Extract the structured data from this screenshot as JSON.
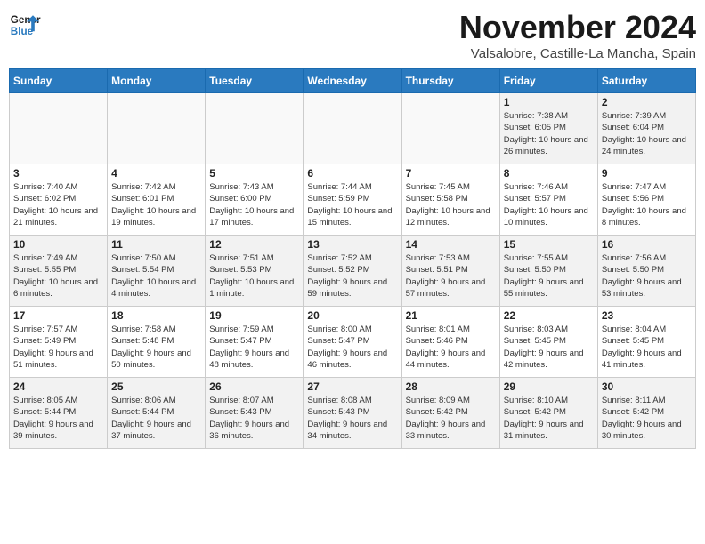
{
  "logo": {
    "line1": "General",
    "line2": "Blue"
  },
  "title": "November 2024",
  "subtitle": "Valsalobre, Castille-La Mancha, Spain",
  "weekdays": [
    "Sunday",
    "Monday",
    "Tuesday",
    "Wednesday",
    "Thursday",
    "Friday",
    "Saturday"
  ],
  "weeks": [
    [
      {
        "day": "",
        "info": ""
      },
      {
        "day": "",
        "info": ""
      },
      {
        "day": "",
        "info": ""
      },
      {
        "day": "",
        "info": ""
      },
      {
        "day": "",
        "info": ""
      },
      {
        "day": "1",
        "info": "Sunrise: 7:38 AM\nSunset: 6:05 PM\nDaylight: 10 hours and 26 minutes."
      },
      {
        "day": "2",
        "info": "Sunrise: 7:39 AM\nSunset: 6:04 PM\nDaylight: 10 hours and 24 minutes."
      }
    ],
    [
      {
        "day": "3",
        "info": "Sunrise: 7:40 AM\nSunset: 6:02 PM\nDaylight: 10 hours and 21 minutes."
      },
      {
        "day": "4",
        "info": "Sunrise: 7:42 AM\nSunset: 6:01 PM\nDaylight: 10 hours and 19 minutes."
      },
      {
        "day": "5",
        "info": "Sunrise: 7:43 AM\nSunset: 6:00 PM\nDaylight: 10 hours and 17 minutes."
      },
      {
        "day": "6",
        "info": "Sunrise: 7:44 AM\nSunset: 5:59 PM\nDaylight: 10 hours and 15 minutes."
      },
      {
        "day": "7",
        "info": "Sunrise: 7:45 AM\nSunset: 5:58 PM\nDaylight: 10 hours and 12 minutes."
      },
      {
        "day": "8",
        "info": "Sunrise: 7:46 AM\nSunset: 5:57 PM\nDaylight: 10 hours and 10 minutes."
      },
      {
        "day": "9",
        "info": "Sunrise: 7:47 AM\nSunset: 5:56 PM\nDaylight: 10 hours and 8 minutes."
      }
    ],
    [
      {
        "day": "10",
        "info": "Sunrise: 7:49 AM\nSunset: 5:55 PM\nDaylight: 10 hours and 6 minutes."
      },
      {
        "day": "11",
        "info": "Sunrise: 7:50 AM\nSunset: 5:54 PM\nDaylight: 10 hours and 4 minutes."
      },
      {
        "day": "12",
        "info": "Sunrise: 7:51 AM\nSunset: 5:53 PM\nDaylight: 10 hours and 1 minute."
      },
      {
        "day": "13",
        "info": "Sunrise: 7:52 AM\nSunset: 5:52 PM\nDaylight: 9 hours and 59 minutes."
      },
      {
        "day": "14",
        "info": "Sunrise: 7:53 AM\nSunset: 5:51 PM\nDaylight: 9 hours and 57 minutes."
      },
      {
        "day": "15",
        "info": "Sunrise: 7:55 AM\nSunset: 5:50 PM\nDaylight: 9 hours and 55 minutes."
      },
      {
        "day": "16",
        "info": "Sunrise: 7:56 AM\nSunset: 5:50 PM\nDaylight: 9 hours and 53 minutes."
      }
    ],
    [
      {
        "day": "17",
        "info": "Sunrise: 7:57 AM\nSunset: 5:49 PM\nDaylight: 9 hours and 51 minutes."
      },
      {
        "day": "18",
        "info": "Sunrise: 7:58 AM\nSunset: 5:48 PM\nDaylight: 9 hours and 50 minutes."
      },
      {
        "day": "19",
        "info": "Sunrise: 7:59 AM\nSunset: 5:47 PM\nDaylight: 9 hours and 48 minutes."
      },
      {
        "day": "20",
        "info": "Sunrise: 8:00 AM\nSunset: 5:47 PM\nDaylight: 9 hours and 46 minutes."
      },
      {
        "day": "21",
        "info": "Sunrise: 8:01 AM\nSunset: 5:46 PM\nDaylight: 9 hours and 44 minutes."
      },
      {
        "day": "22",
        "info": "Sunrise: 8:03 AM\nSunset: 5:45 PM\nDaylight: 9 hours and 42 minutes."
      },
      {
        "day": "23",
        "info": "Sunrise: 8:04 AM\nSunset: 5:45 PM\nDaylight: 9 hours and 41 minutes."
      }
    ],
    [
      {
        "day": "24",
        "info": "Sunrise: 8:05 AM\nSunset: 5:44 PM\nDaylight: 9 hours and 39 minutes."
      },
      {
        "day": "25",
        "info": "Sunrise: 8:06 AM\nSunset: 5:44 PM\nDaylight: 9 hours and 37 minutes."
      },
      {
        "day": "26",
        "info": "Sunrise: 8:07 AM\nSunset: 5:43 PM\nDaylight: 9 hours and 36 minutes."
      },
      {
        "day": "27",
        "info": "Sunrise: 8:08 AM\nSunset: 5:43 PM\nDaylight: 9 hours and 34 minutes."
      },
      {
        "day": "28",
        "info": "Sunrise: 8:09 AM\nSunset: 5:42 PM\nDaylight: 9 hours and 33 minutes."
      },
      {
        "day": "29",
        "info": "Sunrise: 8:10 AM\nSunset: 5:42 PM\nDaylight: 9 hours and 31 minutes."
      },
      {
        "day": "30",
        "info": "Sunrise: 8:11 AM\nSunset: 5:42 PM\nDaylight: 9 hours and 30 minutes."
      }
    ]
  ]
}
